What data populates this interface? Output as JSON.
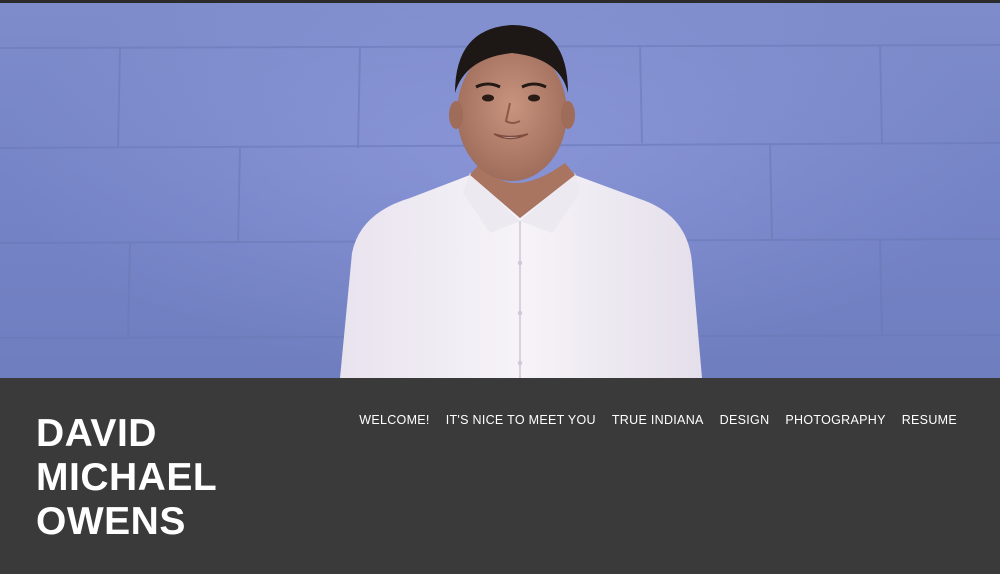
{
  "site": {
    "name_lines": [
      "DAVID",
      "MICHAEL",
      "OWENS"
    ]
  },
  "nav": {
    "items": [
      {
        "label": "WELCOME!"
      },
      {
        "label": "IT'S NICE TO MEET YOU"
      },
      {
        "label": "TRUE INDIANA"
      },
      {
        "label": "DESIGN"
      },
      {
        "label": "PHOTOGRAPHY"
      },
      {
        "label": "RESUME"
      }
    ]
  },
  "hero": {
    "subject": "portrait-photo",
    "wall_color": "#7483c6",
    "shirt_color": "#f4f1f6"
  },
  "colors": {
    "band": "#3a3a3a",
    "text": "#ffffff"
  }
}
